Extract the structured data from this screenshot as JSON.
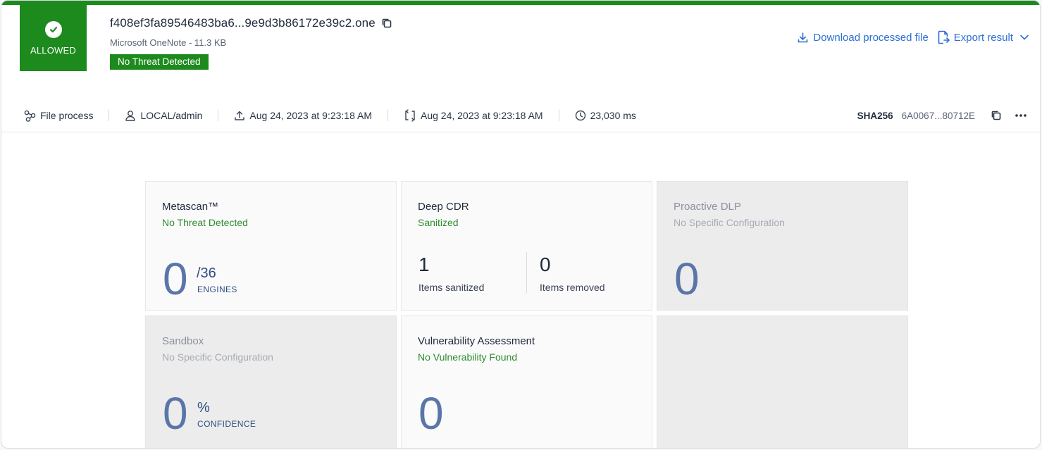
{
  "verdict": {
    "label": "ALLOWED",
    "color": "#1d8a1d",
    "icon": "check-circle-icon"
  },
  "file": {
    "name": "f408ef3fa89546483ba6...9e9d3b86172e39c2.one",
    "meta": "Microsoft OneNote - 11.3 KB",
    "threat_badge": "No Threat Detected"
  },
  "actions": {
    "download_label": "Download processed file",
    "export_label": "Export result"
  },
  "metabar": {
    "process": "File process",
    "user": "LOCAL/admin",
    "uploaded": "Aug 24, 2023 at 9:23:18 AM",
    "processed": "Aug 24, 2023 at 9:23:18 AM",
    "duration": "23,030 ms",
    "sha_label": "SHA256",
    "sha_value": "6A0067...80712E"
  },
  "cards": {
    "metascan": {
      "title": "Metascan™",
      "status": "No Threat Detected",
      "count": "0",
      "total": "/36",
      "unit": "ENGINES"
    },
    "cdr": {
      "title": "Deep CDR",
      "status": "Sanitized",
      "sanitized_count": "1",
      "sanitized_label": "Items sanitized",
      "removed_count": "0",
      "removed_label": "Items removed"
    },
    "dlp": {
      "title": "Proactive DLP",
      "status": "No Specific Configuration",
      "count": "0"
    },
    "sandbox": {
      "title": "Sandbox",
      "status": "No Specific Configuration",
      "count": "0",
      "unit_top": "%",
      "unit": "CONFIDENCE"
    },
    "vuln": {
      "title": "Vulnerability Assessment",
      "status": "No Vulnerability Found",
      "count": "0"
    }
  }
}
